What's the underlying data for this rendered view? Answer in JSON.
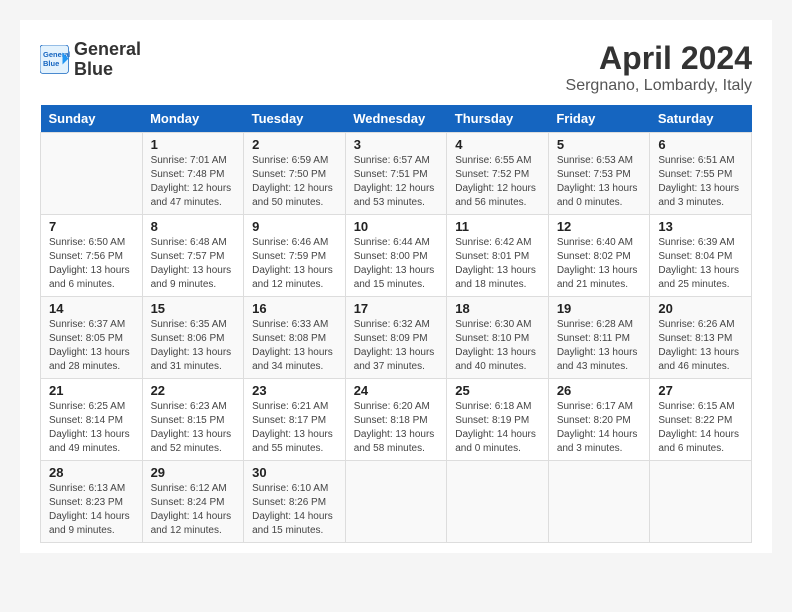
{
  "header": {
    "logo_line1": "General",
    "logo_line2": "Blue",
    "title": "April 2024",
    "subtitle": "Sergnano, Lombardy, Italy"
  },
  "calendar": {
    "days_of_week": [
      "Sunday",
      "Monday",
      "Tuesday",
      "Wednesday",
      "Thursday",
      "Friday",
      "Saturday"
    ],
    "weeks": [
      [
        {
          "day": "",
          "info": ""
        },
        {
          "day": "1",
          "info": "Sunrise: 7:01 AM\nSunset: 7:48 PM\nDaylight: 12 hours\nand 47 minutes."
        },
        {
          "day": "2",
          "info": "Sunrise: 6:59 AM\nSunset: 7:50 PM\nDaylight: 12 hours\nand 50 minutes."
        },
        {
          "day": "3",
          "info": "Sunrise: 6:57 AM\nSunset: 7:51 PM\nDaylight: 12 hours\nand 53 minutes."
        },
        {
          "day": "4",
          "info": "Sunrise: 6:55 AM\nSunset: 7:52 PM\nDaylight: 12 hours\nand 56 minutes."
        },
        {
          "day": "5",
          "info": "Sunrise: 6:53 AM\nSunset: 7:53 PM\nDaylight: 13 hours\nand 0 minutes."
        },
        {
          "day": "6",
          "info": "Sunrise: 6:51 AM\nSunset: 7:55 PM\nDaylight: 13 hours\nand 3 minutes."
        }
      ],
      [
        {
          "day": "7",
          "info": "Sunrise: 6:50 AM\nSunset: 7:56 PM\nDaylight: 13 hours\nand 6 minutes."
        },
        {
          "day": "8",
          "info": "Sunrise: 6:48 AM\nSunset: 7:57 PM\nDaylight: 13 hours\nand 9 minutes."
        },
        {
          "day": "9",
          "info": "Sunrise: 6:46 AM\nSunset: 7:59 PM\nDaylight: 13 hours\nand 12 minutes."
        },
        {
          "day": "10",
          "info": "Sunrise: 6:44 AM\nSunset: 8:00 PM\nDaylight: 13 hours\nand 15 minutes."
        },
        {
          "day": "11",
          "info": "Sunrise: 6:42 AM\nSunset: 8:01 PM\nDaylight: 13 hours\nand 18 minutes."
        },
        {
          "day": "12",
          "info": "Sunrise: 6:40 AM\nSunset: 8:02 PM\nDaylight: 13 hours\nand 21 minutes."
        },
        {
          "day": "13",
          "info": "Sunrise: 6:39 AM\nSunset: 8:04 PM\nDaylight: 13 hours\nand 25 minutes."
        }
      ],
      [
        {
          "day": "14",
          "info": "Sunrise: 6:37 AM\nSunset: 8:05 PM\nDaylight: 13 hours\nand 28 minutes."
        },
        {
          "day": "15",
          "info": "Sunrise: 6:35 AM\nSunset: 8:06 PM\nDaylight: 13 hours\nand 31 minutes."
        },
        {
          "day": "16",
          "info": "Sunrise: 6:33 AM\nSunset: 8:08 PM\nDaylight: 13 hours\nand 34 minutes."
        },
        {
          "day": "17",
          "info": "Sunrise: 6:32 AM\nSunset: 8:09 PM\nDaylight: 13 hours\nand 37 minutes."
        },
        {
          "day": "18",
          "info": "Sunrise: 6:30 AM\nSunset: 8:10 PM\nDaylight: 13 hours\nand 40 minutes."
        },
        {
          "day": "19",
          "info": "Sunrise: 6:28 AM\nSunset: 8:11 PM\nDaylight: 13 hours\nand 43 minutes."
        },
        {
          "day": "20",
          "info": "Sunrise: 6:26 AM\nSunset: 8:13 PM\nDaylight: 13 hours\nand 46 minutes."
        }
      ],
      [
        {
          "day": "21",
          "info": "Sunrise: 6:25 AM\nSunset: 8:14 PM\nDaylight: 13 hours\nand 49 minutes."
        },
        {
          "day": "22",
          "info": "Sunrise: 6:23 AM\nSunset: 8:15 PM\nDaylight: 13 hours\nand 52 minutes."
        },
        {
          "day": "23",
          "info": "Sunrise: 6:21 AM\nSunset: 8:17 PM\nDaylight: 13 hours\nand 55 minutes."
        },
        {
          "day": "24",
          "info": "Sunrise: 6:20 AM\nSunset: 8:18 PM\nDaylight: 13 hours\nand 58 minutes."
        },
        {
          "day": "25",
          "info": "Sunrise: 6:18 AM\nSunset: 8:19 PM\nDaylight: 14 hours\nand 0 minutes."
        },
        {
          "day": "26",
          "info": "Sunrise: 6:17 AM\nSunset: 8:20 PM\nDaylight: 14 hours\nand 3 minutes."
        },
        {
          "day": "27",
          "info": "Sunrise: 6:15 AM\nSunset: 8:22 PM\nDaylight: 14 hours\nand 6 minutes."
        }
      ],
      [
        {
          "day": "28",
          "info": "Sunrise: 6:13 AM\nSunset: 8:23 PM\nDaylight: 14 hours\nand 9 minutes."
        },
        {
          "day": "29",
          "info": "Sunrise: 6:12 AM\nSunset: 8:24 PM\nDaylight: 14 hours\nand 12 minutes."
        },
        {
          "day": "30",
          "info": "Sunrise: 6:10 AM\nSunset: 8:26 PM\nDaylight: 14 hours\nand 15 minutes."
        },
        {
          "day": "",
          "info": ""
        },
        {
          "day": "",
          "info": ""
        },
        {
          "day": "",
          "info": ""
        },
        {
          "day": "",
          "info": ""
        }
      ]
    ]
  }
}
